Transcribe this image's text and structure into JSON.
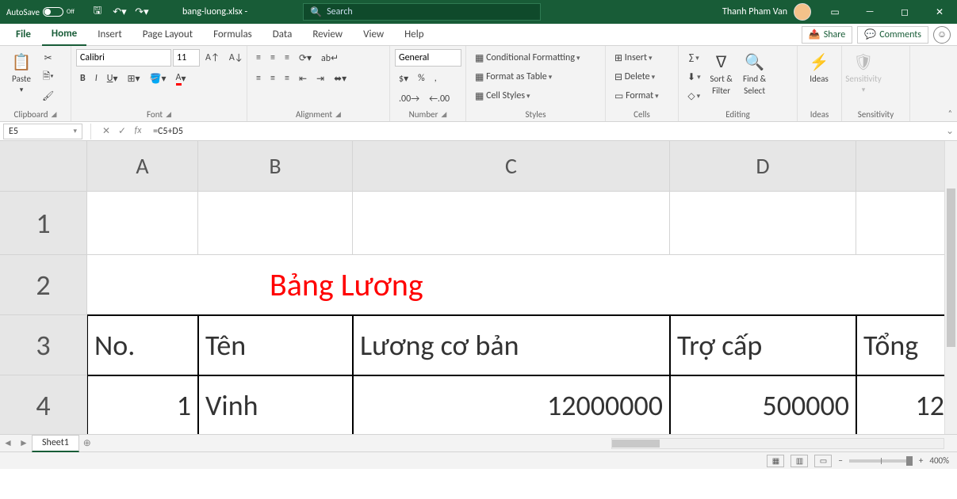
{
  "titlebar": {
    "autosave_label": "AutoSave",
    "autosave_state": "Off",
    "filename": "bang-luong.xlsx  -",
    "search_placeholder": "Search",
    "username": "Thanh Pham Van"
  },
  "tabs": {
    "file": "File",
    "home": "Home",
    "insert": "Insert",
    "page_layout": "Page Layout",
    "formulas": "Formulas",
    "data": "Data",
    "review": "Review",
    "view": "View",
    "help": "Help",
    "share": "Share",
    "comments": "Comments"
  },
  "ribbon": {
    "clipboard": {
      "paste": "Paste",
      "label": "Clipboard"
    },
    "font": {
      "name": "Calibri",
      "size": "11",
      "label": "Font"
    },
    "alignment": {
      "label": "Alignment"
    },
    "number": {
      "format": "General",
      "label": "Number"
    },
    "styles": {
      "cond": "Conditional Formatting",
      "table": "Format as Table",
      "cell": "Cell Styles",
      "label": "Styles"
    },
    "cells": {
      "insert": "Insert",
      "delete": "Delete",
      "format": "Format",
      "label": "Cells"
    },
    "editing": {
      "sort": "Sort &",
      "filter": "Filter",
      "find": "Find &",
      "select": "Select",
      "label": "Editing"
    },
    "ideas": {
      "btn": "Ideas",
      "label": "Ideas"
    },
    "sens": {
      "btn": "Sensitivity",
      "label": "Sensitivity"
    }
  },
  "formula_bar": {
    "name_box": "E5",
    "formula": "=C5+D5"
  },
  "grid": {
    "col_headers": [
      "A",
      "B",
      "C",
      "D",
      ""
    ],
    "row_headers": [
      "1",
      "2",
      "3",
      "4"
    ],
    "title_row": "Bảng Lương",
    "headers": {
      "a": "No.",
      "b": "Tên",
      "c": "Lương cơ bản",
      "d": "Trợ cấp",
      "e": "Tổng"
    },
    "row1": {
      "a": "1",
      "b": "Vinh",
      "c": "12000000",
      "d": "500000",
      "e": "12"
    }
  },
  "sheet": {
    "name": "Sheet1"
  },
  "status": {
    "zoom": "400%"
  }
}
